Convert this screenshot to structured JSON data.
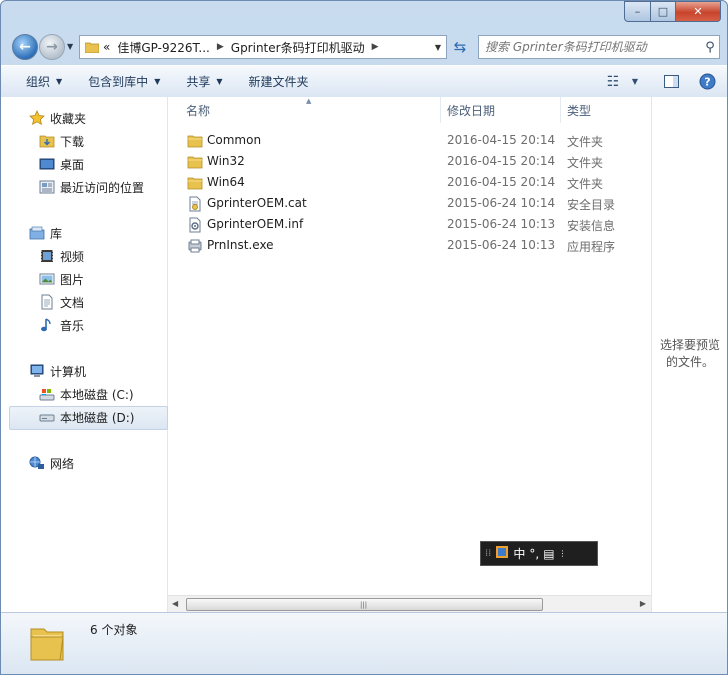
{
  "window": {
    "controls": {
      "minimize": "–",
      "maximize": "□",
      "close": "✕"
    }
  },
  "address": {
    "overflow": "«",
    "crumbs": [
      "佳博GP-9226T...",
      "Gprinter条码打印机驱动"
    ],
    "search_placeholder": "搜索 Gprinter条码打印机驱动"
  },
  "toolbar": {
    "organize": "组织",
    "include_in_library": "包含到库中",
    "share": "共享",
    "new_folder": "新建文件夹"
  },
  "nav": {
    "favorites": {
      "label": "收藏夹",
      "items": [
        "下载",
        "桌面",
        "最近访问的位置"
      ]
    },
    "libraries": {
      "label": "库",
      "items": [
        "视频",
        "图片",
        "文档",
        "音乐"
      ]
    },
    "computer": {
      "label": "计算机",
      "items": [
        "本地磁盘 (C:)",
        "本地磁盘 (D:)"
      ]
    },
    "network": {
      "label": "网络"
    }
  },
  "columns": {
    "name": "名称",
    "date": "修改日期",
    "type": "类型"
  },
  "files": [
    {
      "name": "Common",
      "date": "2016-04-15 20:14",
      "type": "文件夹",
      "icon": "folder-icon"
    },
    {
      "name": "Win32",
      "date": "2016-04-15 20:14",
      "type": "文件夹",
      "icon": "folder-icon"
    },
    {
      "name": "Win64",
      "date": "2016-04-15 20:14",
      "type": "文件夹",
      "icon": "folder-icon"
    },
    {
      "name": "GprinterOEM.cat",
      "date": "2015-06-24 10:14",
      "type": "安全目录",
      "icon": "security-catalog-icon"
    },
    {
      "name": "GprinterOEM.inf",
      "date": "2015-06-24 10:13",
      "type": "安装信息",
      "icon": "setup-info-icon"
    },
    {
      "name": "PrnInst.exe",
      "date": "2015-06-24 10:13",
      "type": "应用程序",
      "icon": "application-icon"
    }
  ],
  "preview": {
    "line1": "选择要预览",
    "line2": "的文件。"
  },
  "ime": {
    "mode": "中",
    "punct": "°,"
  },
  "details": {
    "count": "6 个对象"
  },
  "colors": {
    "folder": "#e8c24e",
    "selection": "#dce6f2",
    "window_frame": "#b8d0ea"
  }
}
